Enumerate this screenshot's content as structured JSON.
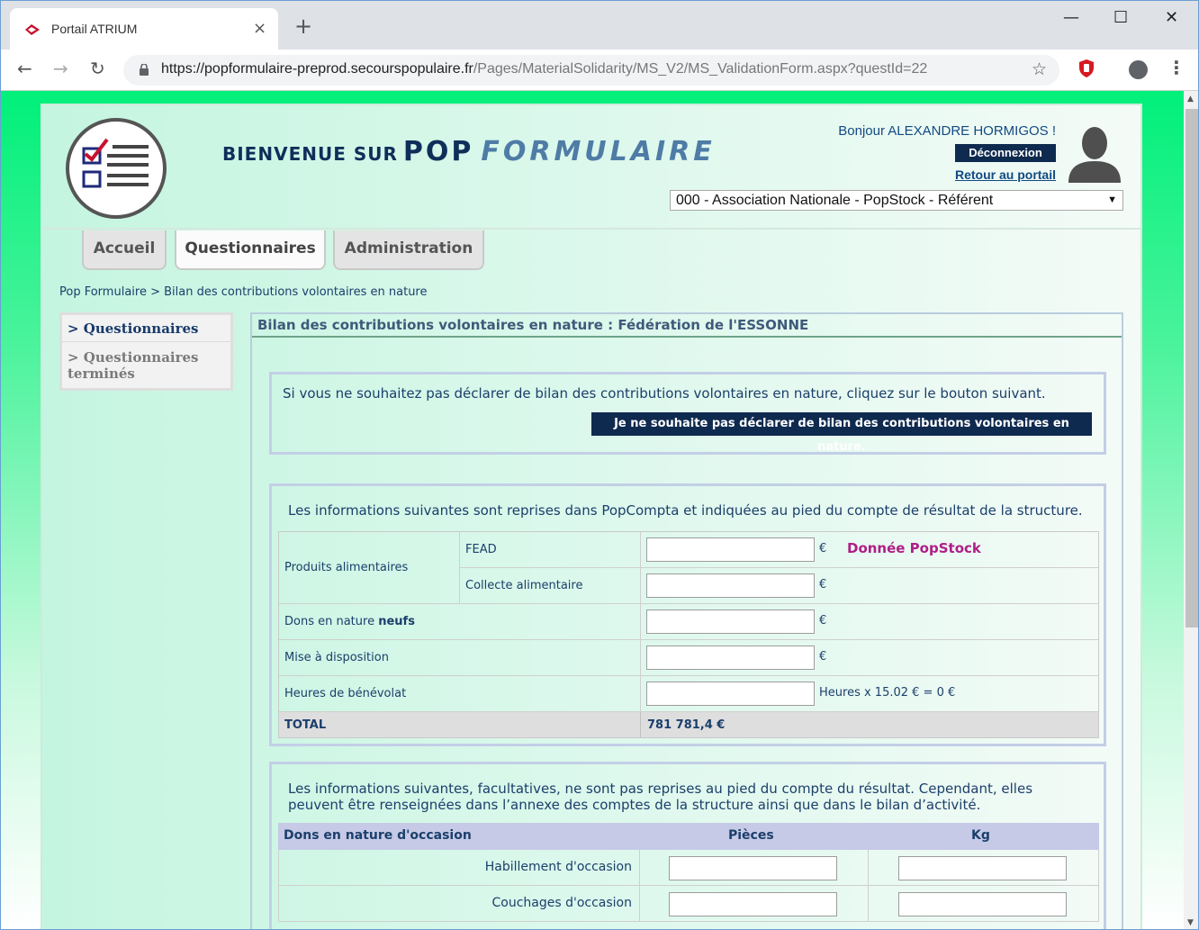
{
  "browser": {
    "tab_title": "Portail ATRIUM",
    "tab_close": "×",
    "new_tab": "+",
    "url_host": "https://popformulaire-preprod.secourspopulaire.fr",
    "url_path": "/Pages/MaterialSolidarity/MS_V2/MS_ValidationForm.aspx?questId=22",
    "win_minimize": "—",
    "win_maximize": "☐",
    "win_close": "✕",
    "back": "←",
    "forward": "→",
    "reload": "↻",
    "star": "☆",
    "menu": "⋮"
  },
  "header": {
    "welcome_prefix": "BIENVENUE SUR",
    "welcome_pop": "POP",
    "welcome_formulaire": "FORMULAIRE",
    "greeting": "Bonjour ALEXANDRE HORMIGOS !",
    "logout": "Déconnexion",
    "portal_link": "Retour au portail",
    "structure_selected": "000 - Association Nationale - PopStock - Référent",
    "select_arrow": "▼"
  },
  "nav": {
    "tabs": [
      {
        "label": "Accueil"
      },
      {
        "label": "Questionnaires"
      },
      {
        "label": "Administration"
      }
    ],
    "active": "Questionnaires"
  },
  "breadcrumb": "Pop Formulaire > Bilan des contributions volontaires en nature",
  "sidebar": {
    "items": [
      {
        "label": "> Questionnaires"
      },
      {
        "label": "> Questionnaires terminés"
      }
    ]
  },
  "main": {
    "title": "Bilan des contributions volontaires en nature : Fédération de l'ESSONNE",
    "decline_text": "Si vous ne souhaitez pas déclarer de bilan des contributions volontaires en nature, cliquez sur le bouton suivant.",
    "decline_button": "Je ne souhaite pas déclarer de bilan des contributions volontaires en nature.",
    "section1_intro": "Les informations suivantes sont reprises dans PopCompta et indiquées au pied du compte de résultat de la structure.",
    "rows": {
      "produits_alimentaires": "Produits alimentaires",
      "fead": "FEAD",
      "collecte": "Collecte alimentaire",
      "dons_prefix": "Dons en nature",
      "dons_bold": "neufs",
      "mise_dispo": "Mise à disposition",
      "heures": "Heures de bénévolat",
      "heures_calc": "Heures x 15.02 € = 0 €",
      "total_label": "TOTAL",
      "total_value": "781 781,4 €",
      "currency": "€",
      "popstock_note": "Donnée PopStock"
    },
    "section2_intro": "Les informations suivantes, facultatives, ne sont pas reprises au pied du compte du résultat. Cependant, elles peuvent être renseignées dans l’annexe des comptes de la structure ainsi que dans le bilan d’activité.",
    "occasion": {
      "header": "Dons en nature d'occasion",
      "col_pieces": "Pièces",
      "col_kg": "Kg",
      "rows": [
        "Habillement d'occasion",
        "Couchages d'occasion"
      ]
    }
  },
  "colors": {
    "navy": "#0f2a4f",
    "accent_green": "#00f07a",
    "popstock_magenta": "#b01e87"
  }
}
